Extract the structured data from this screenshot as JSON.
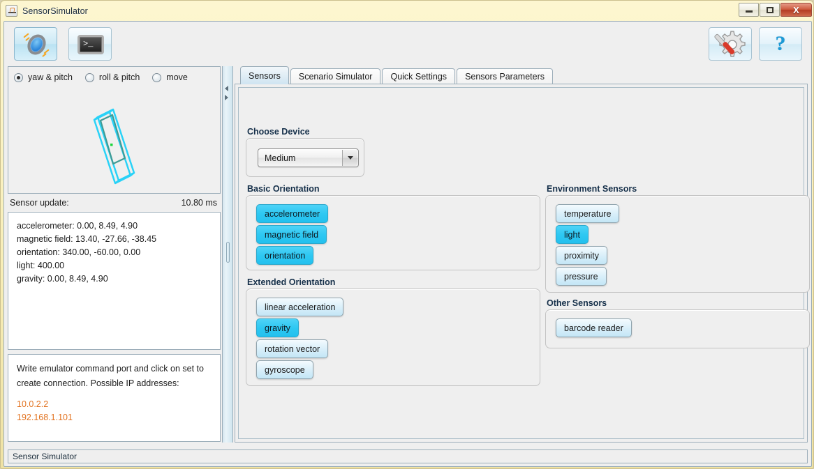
{
  "window": {
    "title": "SensorSimulator",
    "app_icon": "java-coffee-icon",
    "controls": {
      "minimize": "minimize-icon",
      "maximize": "maximize-icon",
      "close": "X"
    }
  },
  "toolbar": {
    "buttons": [
      {
        "name": "sensor-simulator-button",
        "icon": "sensor-icon",
        "active": true
      },
      {
        "name": "telnet-console-button",
        "icon": "terminal-icon",
        "active": false
      },
      {
        "name": "settings-button",
        "icon": "gear-screwdriver-icon",
        "active": false
      },
      {
        "name": "help-button",
        "icon": "question-mark-icon",
        "active": false
      }
    ]
  },
  "left_panel": {
    "radios": [
      {
        "label": "yaw & pitch",
        "selected": true
      },
      {
        "label": "roll & pitch",
        "selected": false
      },
      {
        "label": "move",
        "selected": false
      }
    ],
    "phone_preview": "phone-wireframe",
    "sensor_update_label": "Sensor update:",
    "sensor_update_value": "10.80 ms",
    "readout": [
      "accelerometer: 0.00, 8.49, 4.90",
      "magnetic field: 13.40, -27.66, -38.45",
      "orientation: 340.00, -60.00, 0.00",
      "light: 400.00",
      "gravity: 0.00, 8.49, 4.90"
    ],
    "message": {
      "text": "Write emulator command port and click on set to create connection. Possible IP addresses:",
      "ips": [
        "10.0.2.2",
        "192.168.1.101"
      ],
      "ip_color": "#e2721f"
    }
  },
  "tabs": [
    {
      "label": "Sensors",
      "active": true
    },
    {
      "label": "Scenario Simulator",
      "active": false
    },
    {
      "label": "Quick Settings",
      "active": false
    },
    {
      "label": "Sensors Parameters",
      "active": false
    }
  ],
  "sensors_tab": {
    "choose_device": {
      "label": "Choose Device",
      "selected": "Medium",
      "options": [
        "Medium"
      ]
    },
    "groups": [
      {
        "name": "basic-orientation",
        "label": "Basic Orientation",
        "buttons": [
          {
            "label": "accelerometer",
            "active": true
          },
          {
            "label": "magnetic field",
            "active": true
          },
          {
            "label": "orientation",
            "active": true
          }
        ]
      },
      {
        "name": "extended-orientation",
        "label": "Extended Orientation",
        "buttons": [
          {
            "label": "linear acceleration",
            "active": false
          },
          {
            "label": "gravity",
            "active": true
          },
          {
            "label": "rotation vector",
            "active": false
          },
          {
            "label": "gyroscope",
            "active": false
          }
        ]
      },
      {
        "name": "environment-sensors",
        "label": "Environment Sensors",
        "buttons": [
          {
            "label": "temperature",
            "active": false
          },
          {
            "label": "light",
            "active": true
          },
          {
            "label": "proximity",
            "active": false
          },
          {
            "label": "pressure",
            "active": false
          }
        ]
      },
      {
        "name": "other-sensors",
        "label": "Other Sensors",
        "buttons": [
          {
            "label": "barcode reader",
            "active": false
          }
        ]
      }
    ]
  },
  "statusbar": {
    "text": "Sensor Simulator"
  },
  "colors": {
    "active_sensor": "#2ec8f2",
    "inactive_sensor": "#dcf0fa",
    "ip_text": "#e2721f",
    "titlebar": "#f8eeb8",
    "wireframe": "#29d2f7"
  }
}
